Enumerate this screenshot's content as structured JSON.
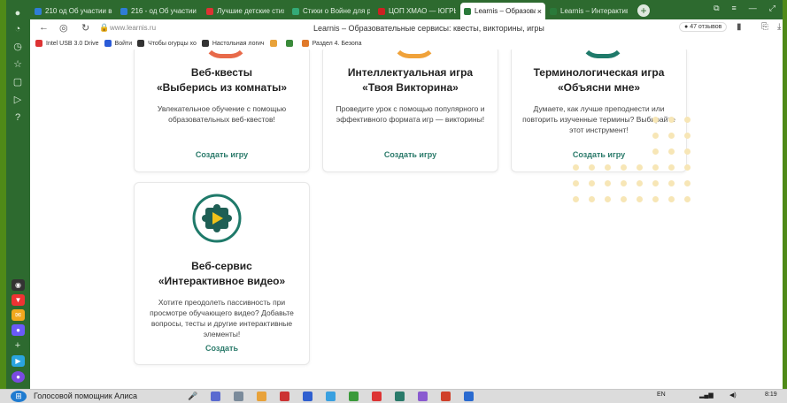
{
  "tabs": [
    {
      "label": "210 од Об участии в",
      "icon": "document-icon",
      "color": "#2f7dd6"
    },
    {
      "label": "216 - од Об участии в",
      "icon": "document-icon",
      "color": "#2f7dd6"
    },
    {
      "label": "Лучшие детские стих",
      "icon": "page-icon",
      "color": "#d33"
    },
    {
      "label": "Стихи о Войне для ре",
      "icon": "page-icon",
      "color": "#3a7"
    },
    {
      "label": "ЦОП ХМАО — ЮГРЫ",
      "icon": "page-icon",
      "color": "#c22"
    },
    {
      "label": "Learnis – Образова",
      "icon": "learnis-icon",
      "color": "#2a7a3a",
      "active": true
    },
    {
      "label": "Learnis – Интерактивн",
      "icon": "learnis-icon",
      "color": "#2a7a3a"
    }
  ],
  "address": {
    "url": "www.learnis.ru",
    "page_title": "Learnis – Образовательные сервисы: квесты, викторины, игры",
    "reviews": "47 отзывов"
  },
  "bookmarks": [
    {
      "label": "Intel USB 3.0 Drive",
      "color": "#d33"
    },
    {
      "label": "Войти",
      "color": "#2a5bd7"
    },
    {
      "label": "Чтобы огурцы хо",
      "color": "#333"
    },
    {
      "label": "Настольная логич",
      "color": "#333"
    },
    {
      "label": "",
      "color": "#e8a23a"
    },
    {
      "label": "",
      "color": "#3a8a3a"
    },
    {
      "label": "Раздел 4. Безопа",
      "color": "#e07a2a"
    }
  ],
  "cards": [
    {
      "title1": "Веб-квесты",
      "title2": "«Выберись из комнаты»",
      "desc": "Увлекательное обучение с помощью образовательных веб-квестов!",
      "cta": "Создать игру",
      "arc_color": "#e86a4a"
    },
    {
      "title1": "Интеллектуальная игра",
      "title2": "«Твоя Викторина»",
      "desc": "Проведите урок с помощью популярного и эффективного формата игр — викторины!",
      "cta": "Создать игру",
      "arc_color": "#f0a23a"
    },
    {
      "title1": "Терминологическая игра",
      "title2": "«Объясни мне»",
      "desc": "Думаете, как лучше преподнести или повторить изученные термины? Выбирайте этот инструмент!",
      "cta": "Создать игру",
      "arc_color": "#1f7a6a"
    },
    {
      "title1": "Веб-сервис",
      "title2": "«Интерактивное видео»",
      "desc": "Хотите преодолеть пассивность при просмотре обучающего видео? Добавьте вопросы, тесты и другие интерактивные элементы!",
      "cta": "Создать",
      "icon": "video-puzzle-icon"
    }
  ],
  "taskbar": {
    "assistant": "Голосовой помощник Алиса",
    "lang": "EN",
    "time": "8:19"
  },
  "colors": {
    "browser_green": "#2d6a2f",
    "teal_accent": "#2a7a6a",
    "dot_color": "#f7e6b6"
  }
}
